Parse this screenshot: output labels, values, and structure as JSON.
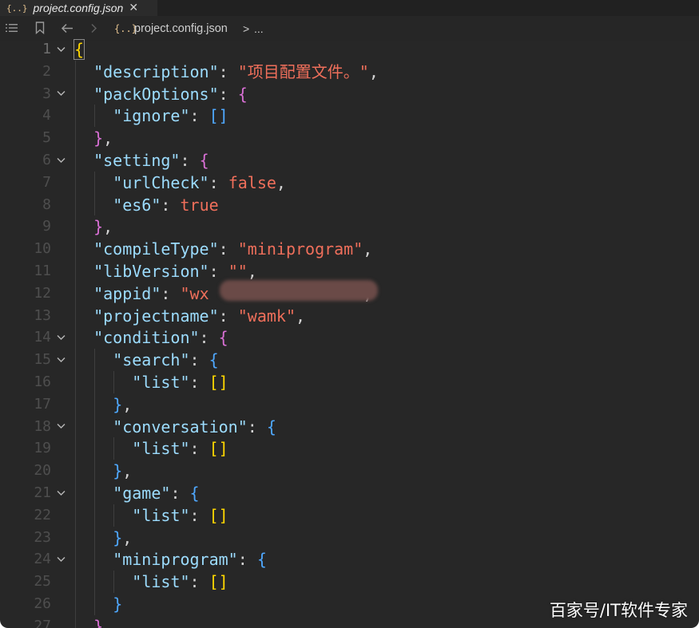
{
  "tab": {
    "icon": "json-braces-icon",
    "glyph": "{..}",
    "title": "project.config.json",
    "close": "✕"
  },
  "breadcrumb": {
    "glyph": "{..}",
    "file": "project.config.json",
    "sep": ">",
    "more": "..."
  },
  "colors": {
    "key": "#9cdcfe",
    "string": "#ef6f5b",
    "bracket_level0": "#ffd700",
    "bracket_level1": "#da70d6",
    "bracket_level2": "#4fa8ff",
    "line_number": "#4e4e4e"
  },
  "editor": {
    "lines": [
      {
        "n": "1",
        "fold": true,
        "indent": 0,
        "tokens": [
          {
            "t": "{",
            "c": "b0"
          }
        ]
      },
      {
        "n": "2",
        "fold": false,
        "indent": 1,
        "tokens": [
          {
            "t": "\"description\"",
            "c": "k"
          },
          {
            "t": ": ",
            "c": "p"
          },
          {
            "t": "\"项目配置文件。\"",
            "c": "s"
          },
          {
            "t": ",",
            "c": "p"
          }
        ]
      },
      {
        "n": "3",
        "fold": true,
        "indent": 1,
        "tokens": [
          {
            "t": "\"packOptions\"",
            "c": "k"
          },
          {
            "t": ": ",
            "c": "p"
          },
          {
            "t": "{",
            "c": "b1"
          }
        ]
      },
      {
        "n": "4",
        "fold": false,
        "indent": 2,
        "tokens": [
          {
            "t": "\"ignore\"",
            "c": "k"
          },
          {
            "t": ": ",
            "c": "p"
          },
          {
            "t": "[]",
            "c": "b2"
          }
        ]
      },
      {
        "n": "5",
        "fold": false,
        "indent": 1,
        "tokens": [
          {
            "t": "}",
            "c": "b1"
          },
          {
            "t": ",",
            "c": "p"
          }
        ]
      },
      {
        "n": "6",
        "fold": true,
        "indent": 1,
        "tokens": [
          {
            "t": "\"setting\"",
            "c": "k"
          },
          {
            "t": ": ",
            "c": "p"
          },
          {
            "t": "{",
            "c": "b1"
          }
        ]
      },
      {
        "n": "7",
        "fold": false,
        "indent": 2,
        "tokens": [
          {
            "t": "\"urlCheck\"",
            "c": "k"
          },
          {
            "t": ": ",
            "c": "p"
          },
          {
            "t": "false",
            "c": "kw"
          },
          {
            "t": ",",
            "c": "p"
          }
        ]
      },
      {
        "n": "8",
        "fold": false,
        "indent": 2,
        "tokens": [
          {
            "t": "\"es6\"",
            "c": "k"
          },
          {
            "t": ": ",
            "c": "p"
          },
          {
            "t": "true",
            "c": "kw"
          }
        ]
      },
      {
        "n": "9",
        "fold": false,
        "indent": 1,
        "tokens": [
          {
            "t": "}",
            "c": "b1"
          },
          {
            "t": ",",
            "c": "p"
          }
        ]
      },
      {
        "n": "10",
        "fold": false,
        "indent": 1,
        "tokens": [
          {
            "t": "\"compileType\"",
            "c": "k"
          },
          {
            "t": ": ",
            "c": "p"
          },
          {
            "t": "\"miniprogram\"",
            "c": "s"
          },
          {
            "t": ",",
            "c": "p"
          }
        ]
      },
      {
        "n": "11",
        "fold": false,
        "indent": 1,
        "tokens": [
          {
            "t": "\"libVersion\"",
            "c": "k"
          },
          {
            "t": ": ",
            "c": "p"
          },
          {
            "t": "\"\"",
            "c": "s"
          },
          {
            "t": ",",
            "c": "p"
          }
        ]
      },
      {
        "n": "12",
        "fold": false,
        "indent": 1,
        "tokens": [
          {
            "t": "\"appid\"",
            "c": "k"
          },
          {
            "t": ": ",
            "c": "p"
          },
          {
            "t": "\"wx",
            "c": "s"
          },
          {
            "t": "               ",
            "c": "p"
          },
          {
            "t": "\"",
            "c": "s"
          },
          {
            "t": ",",
            "c": "p"
          }
        ]
      },
      {
        "n": "13",
        "fold": false,
        "indent": 1,
        "tokens": [
          {
            "t": "\"projectname\"",
            "c": "k"
          },
          {
            "t": ": ",
            "c": "p"
          },
          {
            "t": "\"wamk\"",
            "c": "s"
          },
          {
            "t": ",",
            "c": "p"
          }
        ]
      },
      {
        "n": "14",
        "fold": true,
        "indent": 1,
        "tokens": [
          {
            "t": "\"condition\"",
            "c": "k"
          },
          {
            "t": ": ",
            "c": "p"
          },
          {
            "t": "{",
            "c": "b1"
          }
        ]
      },
      {
        "n": "15",
        "fold": true,
        "indent": 2,
        "tokens": [
          {
            "t": "\"search\"",
            "c": "k"
          },
          {
            "t": ": ",
            "c": "p"
          },
          {
            "t": "{",
            "c": "b2"
          }
        ]
      },
      {
        "n": "16",
        "fold": false,
        "indent": 3,
        "tokens": [
          {
            "t": "\"list\"",
            "c": "k"
          },
          {
            "t": ": ",
            "c": "p"
          },
          {
            "t": "[]",
            "c": "b0"
          }
        ]
      },
      {
        "n": "17",
        "fold": false,
        "indent": 2,
        "tokens": [
          {
            "t": "}",
            "c": "b2"
          },
          {
            "t": ",",
            "c": "p"
          }
        ]
      },
      {
        "n": "18",
        "fold": true,
        "indent": 2,
        "tokens": [
          {
            "t": "\"conversation\"",
            "c": "k"
          },
          {
            "t": ": ",
            "c": "p"
          },
          {
            "t": "{",
            "c": "b2"
          }
        ]
      },
      {
        "n": "19",
        "fold": false,
        "indent": 3,
        "tokens": [
          {
            "t": "\"list\"",
            "c": "k"
          },
          {
            "t": ": ",
            "c": "p"
          },
          {
            "t": "[]",
            "c": "b0"
          }
        ]
      },
      {
        "n": "20",
        "fold": false,
        "indent": 2,
        "tokens": [
          {
            "t": "}",
            "c": "b2"
          },
          {
            "t": ",",
            "c": "p"
          }
        ]
      },
      {
        "n": "21",
        "fold": true,
        "indent": 2,
        "tokens": [
          {
            "t": "\"game\"",
            "c": "k"
          },
          {
            "t": ": ",
            "c": "p"
          },
          {
            "t": "{",
            "c": "b2"
          }
        ]
      },
      {
        "n": "22",
        "fold": false,
        "indent": 3,
        "tokens": [
          {
            "t": "\"list\"",
            "c": "k"
          },
          {
            "t": ": ",
            "c": "p"
          },
          {
            "t": "[]",
            "c": "b0"
          }
        ]
      },
      {
        "n": "23",
        "fold": false,
        "indent": 2,
        "tokens": [
          {
            "t": "}",
            "c": "b2"
          },
          {
            "t": ",",
            "c": "p"
          }
        ]
      },
      {
        "n": "24",
        "fold": true,
        "indent": 2,
        "tokens": [
          {
            "t": "\"miniprogram\"",
            "c": "k"
          },
          {
            "t": ": ",
            "c": "p"
          },
          {
            "t": "{",
            "c": "b2"
          }
        ]
      },
      {
        "n": "25",
        "fold": false,
        "indent": 3,
        "tokens": [
          {
            "t": "\"list\"",
            "c": "k"
          },
          {
            "t": ": ",
            "c": "p"
          },
          {
            "t": "[]",
            "c": "b0"
          }
        ]
      },
      {
        "n": "26",
        "fold": false,
        "indent": 2,
        "tokens": [
          {
            "t": "}",
            "c": "b2"
          }
        ]
      },
      {
        "n": "27",
        "fold": false,
        "indent": 1,
        "tokens": [
          {
            "t": "}",
            "c": "b1"
          }
        ]
      }
    ]
  },
  "watermark": "百家号/IT软件专家"
}
